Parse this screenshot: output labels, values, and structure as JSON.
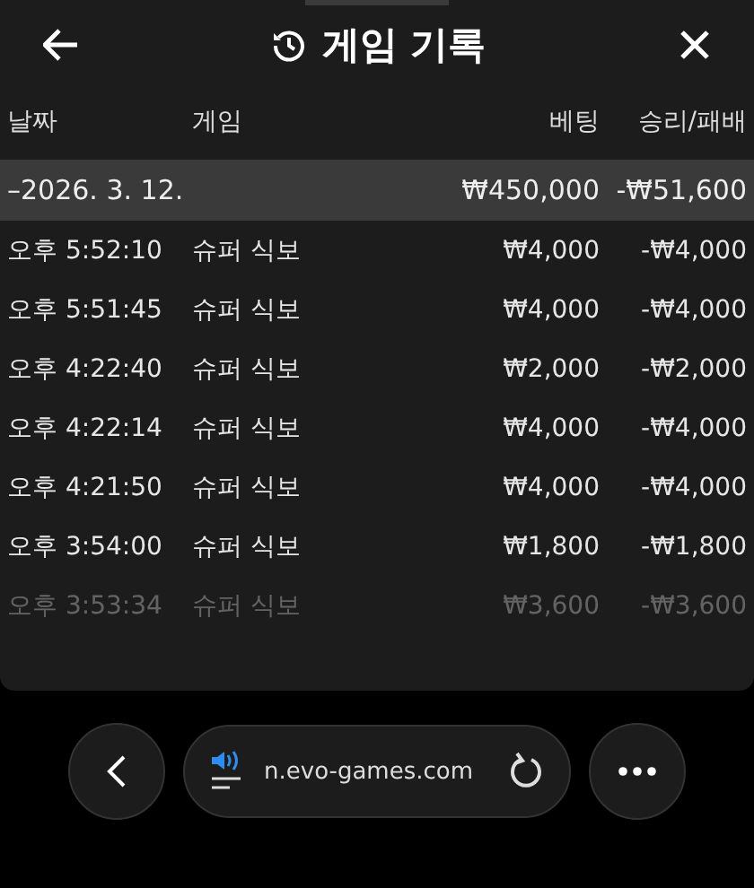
{
  "header": {
    "title": "게임 기록"
  },
  "table": {
    "columns": [
      "날짜",
      "게임",
      "베팅",
      "승리/패배"
    ],
    "group": {
      "date": "–2026. 3. 12.",
      "bet": "₩450,000",
      "result": "-₩51,600"
    },
    "rows": [
      {
        "time": "오후 5:52:10",
        "game": "슈퍼 식보",
        "bet": "₩4,000",
        "result": "-₩4,000",
        "dimmed": false
      },
      {
        "time": "오후 5:51:45",
        "game": "슈퍼 식보",
        "bet": "₩4,000",
        "result": "-₩4,000",
        "dimmed": false
      },
      {
        "time": "오후 4:22:40",
        "game": "슈퍼 식보",
        "bet": "₩2,000",
        "result": "-₩2,000",
        "dimmed": false
      },
      {
        "time": "오후 4:22:14",
        "game": "슈퍼 식보",
        "bet": "₩4,000",
        "result": "-₩4,000",
        "dimmed": false
      },
      {
        "time": "오후 4:21:50",
        "game": "슈퍼 식보",
        "bet": "₩4,000",
        "result": "-₩4,000",
        "dimmed": false
      },
      {
        "time": "오후 3:54:00",
        "game": "슈퍼 식보",
        "bet": "₩1,800",
        "result": "-₩1,800",
        "dimmed": false
      },
      {
        "time": "오후 3:53:34",
        "game": "슈퍼 식보",
        "bet": "₩3,600",
        "result": "-₩3,600",
        "dimmed": true
      }
    ]
  },
  "browser_bar": {
    "url": "n.evo-games.com"
  }
}
